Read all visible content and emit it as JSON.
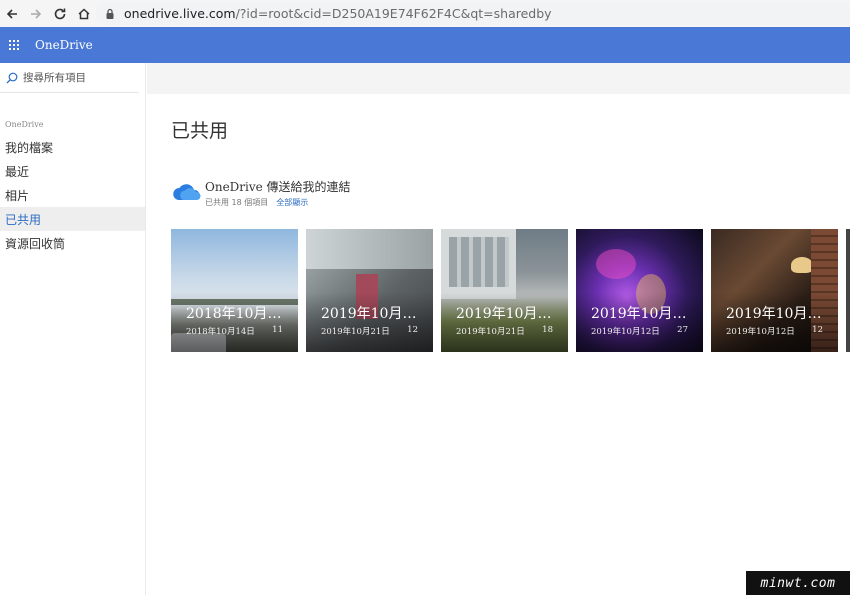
{
  "browser": {
    "url_host": "onedrive.live.com",
    "url_rest": "/?id=root&cid=D250A19E74F62F4C&qt=sharedby"
  },
  "app": {
    "brand": "OneDrive"
  },
  "sidebar": {
    "search_placeholder": "搜尋所有項目",
    "section_label": "OneDrive",
    "items": [
      {
        "label": "我的檔案"
      },
      {
        "label": "最近"
      },
      {
        "label": "相片"
      },
      {
        "label": "已共用"
      },
      {
        "label": "資源回收筒"
      }
    ]
  },
  "main": {
    "title": "已共用",
    "group": {
      "title": "OneDrive 傳送給我的連結",
      "meta": "已共用 18 個項目",
      "see_all": "全部顯示"
    },
    "tiles": [
      {
        "title": "2018年10月…",
        "date": "2018年10月14日",
        "count": "11"
      },
      {
        "title": "2019年10月…",
        "date": "2019年10月21日",
        "count": "12"
      },
      {
        "title": "2019年10月…",
        "date": "2019年10月21日",
        "count": "18"
      },
      {
        "title": "2019年10月…",
        "date": "2019年10月12日",
        "count": "27"
      },
      {
        "title": "2019年10月…",
        "date": "2019年10月12日",
        "count": "12"
      }
    ]
  },
  "watermark": "minwt.com",
  "colors": {
    "header_blue": "#4a78d6",
    "link_blue": "#2b6cc4"
  }
}
